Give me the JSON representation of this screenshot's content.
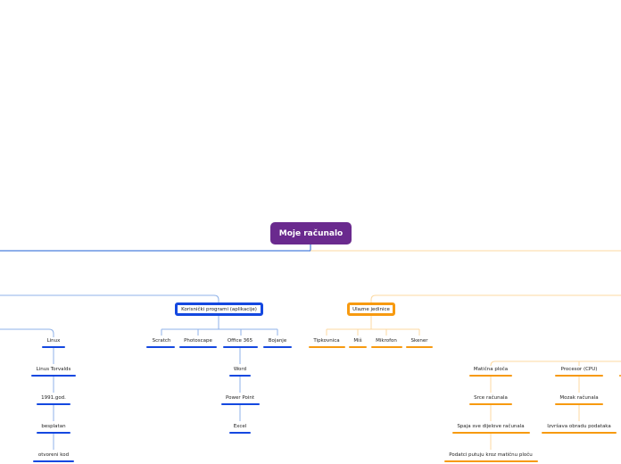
{
  "colors": {
    "root": "#6a2a8e",
    "blue": "#1448e0",
    "blue_line": "#8fb2e8",
    "orange": "#f79a10",
    "orange_line": "#fcd9a0"
  },
  "root": "Moje računalo",
  "branches": {
    "programs": {
      "label": "Korisnički programi (aplikacije)",
      "items": [
        "Scratch",
        "Photoscape",
        "Office 365",
        "Bojanje"
      ],
      "office": [
        "Word",
        "Power Point",
        "Excel"
      ]
    },
    "input": {
      "label": "Ulazne jedinice",
      "items": [
        "Tipkovnica",
        "Miš",
        "Mikrofon",
        "Skener"
      ]
    },
    "linux": [
      "Linux",
      "Linus Torvalds",
      "1991.god.",
      "besplatan",
      "otvoreni kod"
    ],
    "motherboard": [
      "Matična ploča",
      "Srce računala",
      "Spaja sve dijelove računala",
      "Podatci putuju kroz matičnu ploču"
    ],
    "cpu": [
      "Procesor (CPU)",
      "Mozak računala",
      "Izvršava obradu podataka"
    ]
  }
}
